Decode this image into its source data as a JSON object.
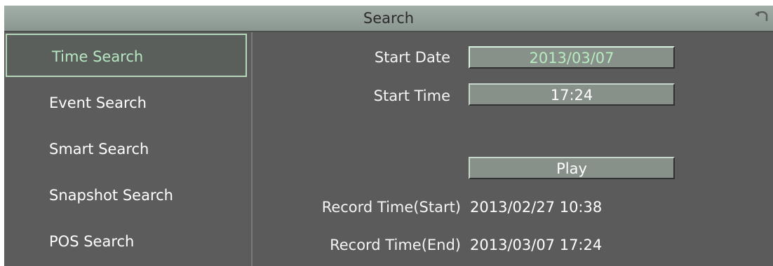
{
  "window": {
    "title": "Search",
    "back_icon": "back-arrow-icon"
  },
  "sidebar": {
    "items": [
      {
        "label": "Time Search",
        "active": true
      },
      {
        "label": "Event Search",
        "active": false
      },
      {
        "label": "Smart Search",
        "active": false
      },
      {
        "label": "Snapshot Search",
        "active": false
      },
      {
        "label": "POS Search",
        "active": false
      }
    ]
  },
  "form": {
    "start_date_label": "Start Date",
    "start_date_value": "2013/03/07",
    "start_time_label": "Start Time",
    "start_time_value": "17:24",
    "play_label": "Play",
    "record_start_label": "Record Time(Start)",
    "record_start_value": "2013/02/27  10:38",
    "record_end_label": "Record Time(End)",
    "record_end_value": "2013/03/07  17:24"
  },
  "colors": {
    "background": "#5b5b5b",
    "titlebar": "#95a09a",
    "field": "#879089",
    "active_text": "#b6e7c2"
  }
}
